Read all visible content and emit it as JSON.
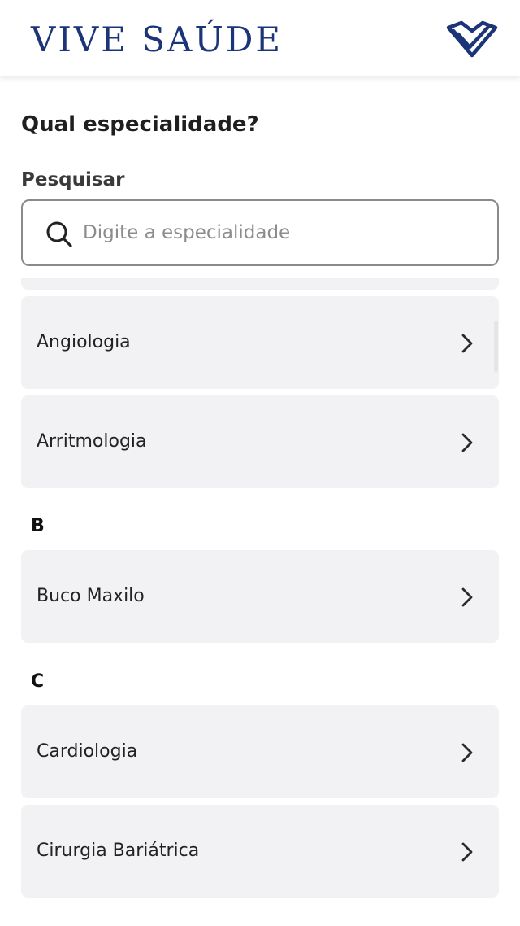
{
  "header": {
    "brand": "VIVE SAÚDE",
    "brand_mark_icon": "vive-heart-check-logo",
    "brand_color": "#1b3578"
  },
  "page": {
    "title": "Qual especialidade?"
  },
  "search": {
    "label": "Pesquisar",
    "placeholder": "Digite a especialidade",
    "value": "",
    "icon": "search-icon"
  },
  "list": {
    "items_a": [
      {
        "label": "Angiologia"
      },
      {
        "label": "Arritmologia"
      }
    ],
    "section_b": "B",
    "items_b": [
      {
        "label": "Buco Maxilo"
      }
    ],
    "section_c": "C",
    "items_c": [
      {
        "label": "Cardiologia"
      },
      {
        "label": "Cirurgia Bariátrica"
      }
    ],
    "chevron_icon": "chevron-right-icon",
    "card_color": "#f2f2f4"
  }
}
